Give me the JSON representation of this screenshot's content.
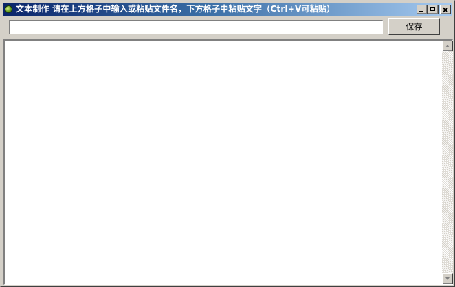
{
  "window": {
    "title": "文本制作 请在上方格子中输入或粘贴文件名，下方格子中粘贴文字（Ctrl+V可粘贴）",
    "icon": "app-icon",
    "controls": {
      "minimize": "minimize-icon",
      "maximize": "maximize-icon",
      "close": "close-icon"
    }
  },
  "filename": {
    "value": "",
    "placeholder": ""
  },
  "toolbar": {
    "save_label": "保存"
  },
  "content": {
    "value": ""
  },
  "colors": {
    "title_gradient_start": "#0a246a",
    "title_gradient_end": "#a6caf0",
    "face": "#d4d0c8"
  }
}
